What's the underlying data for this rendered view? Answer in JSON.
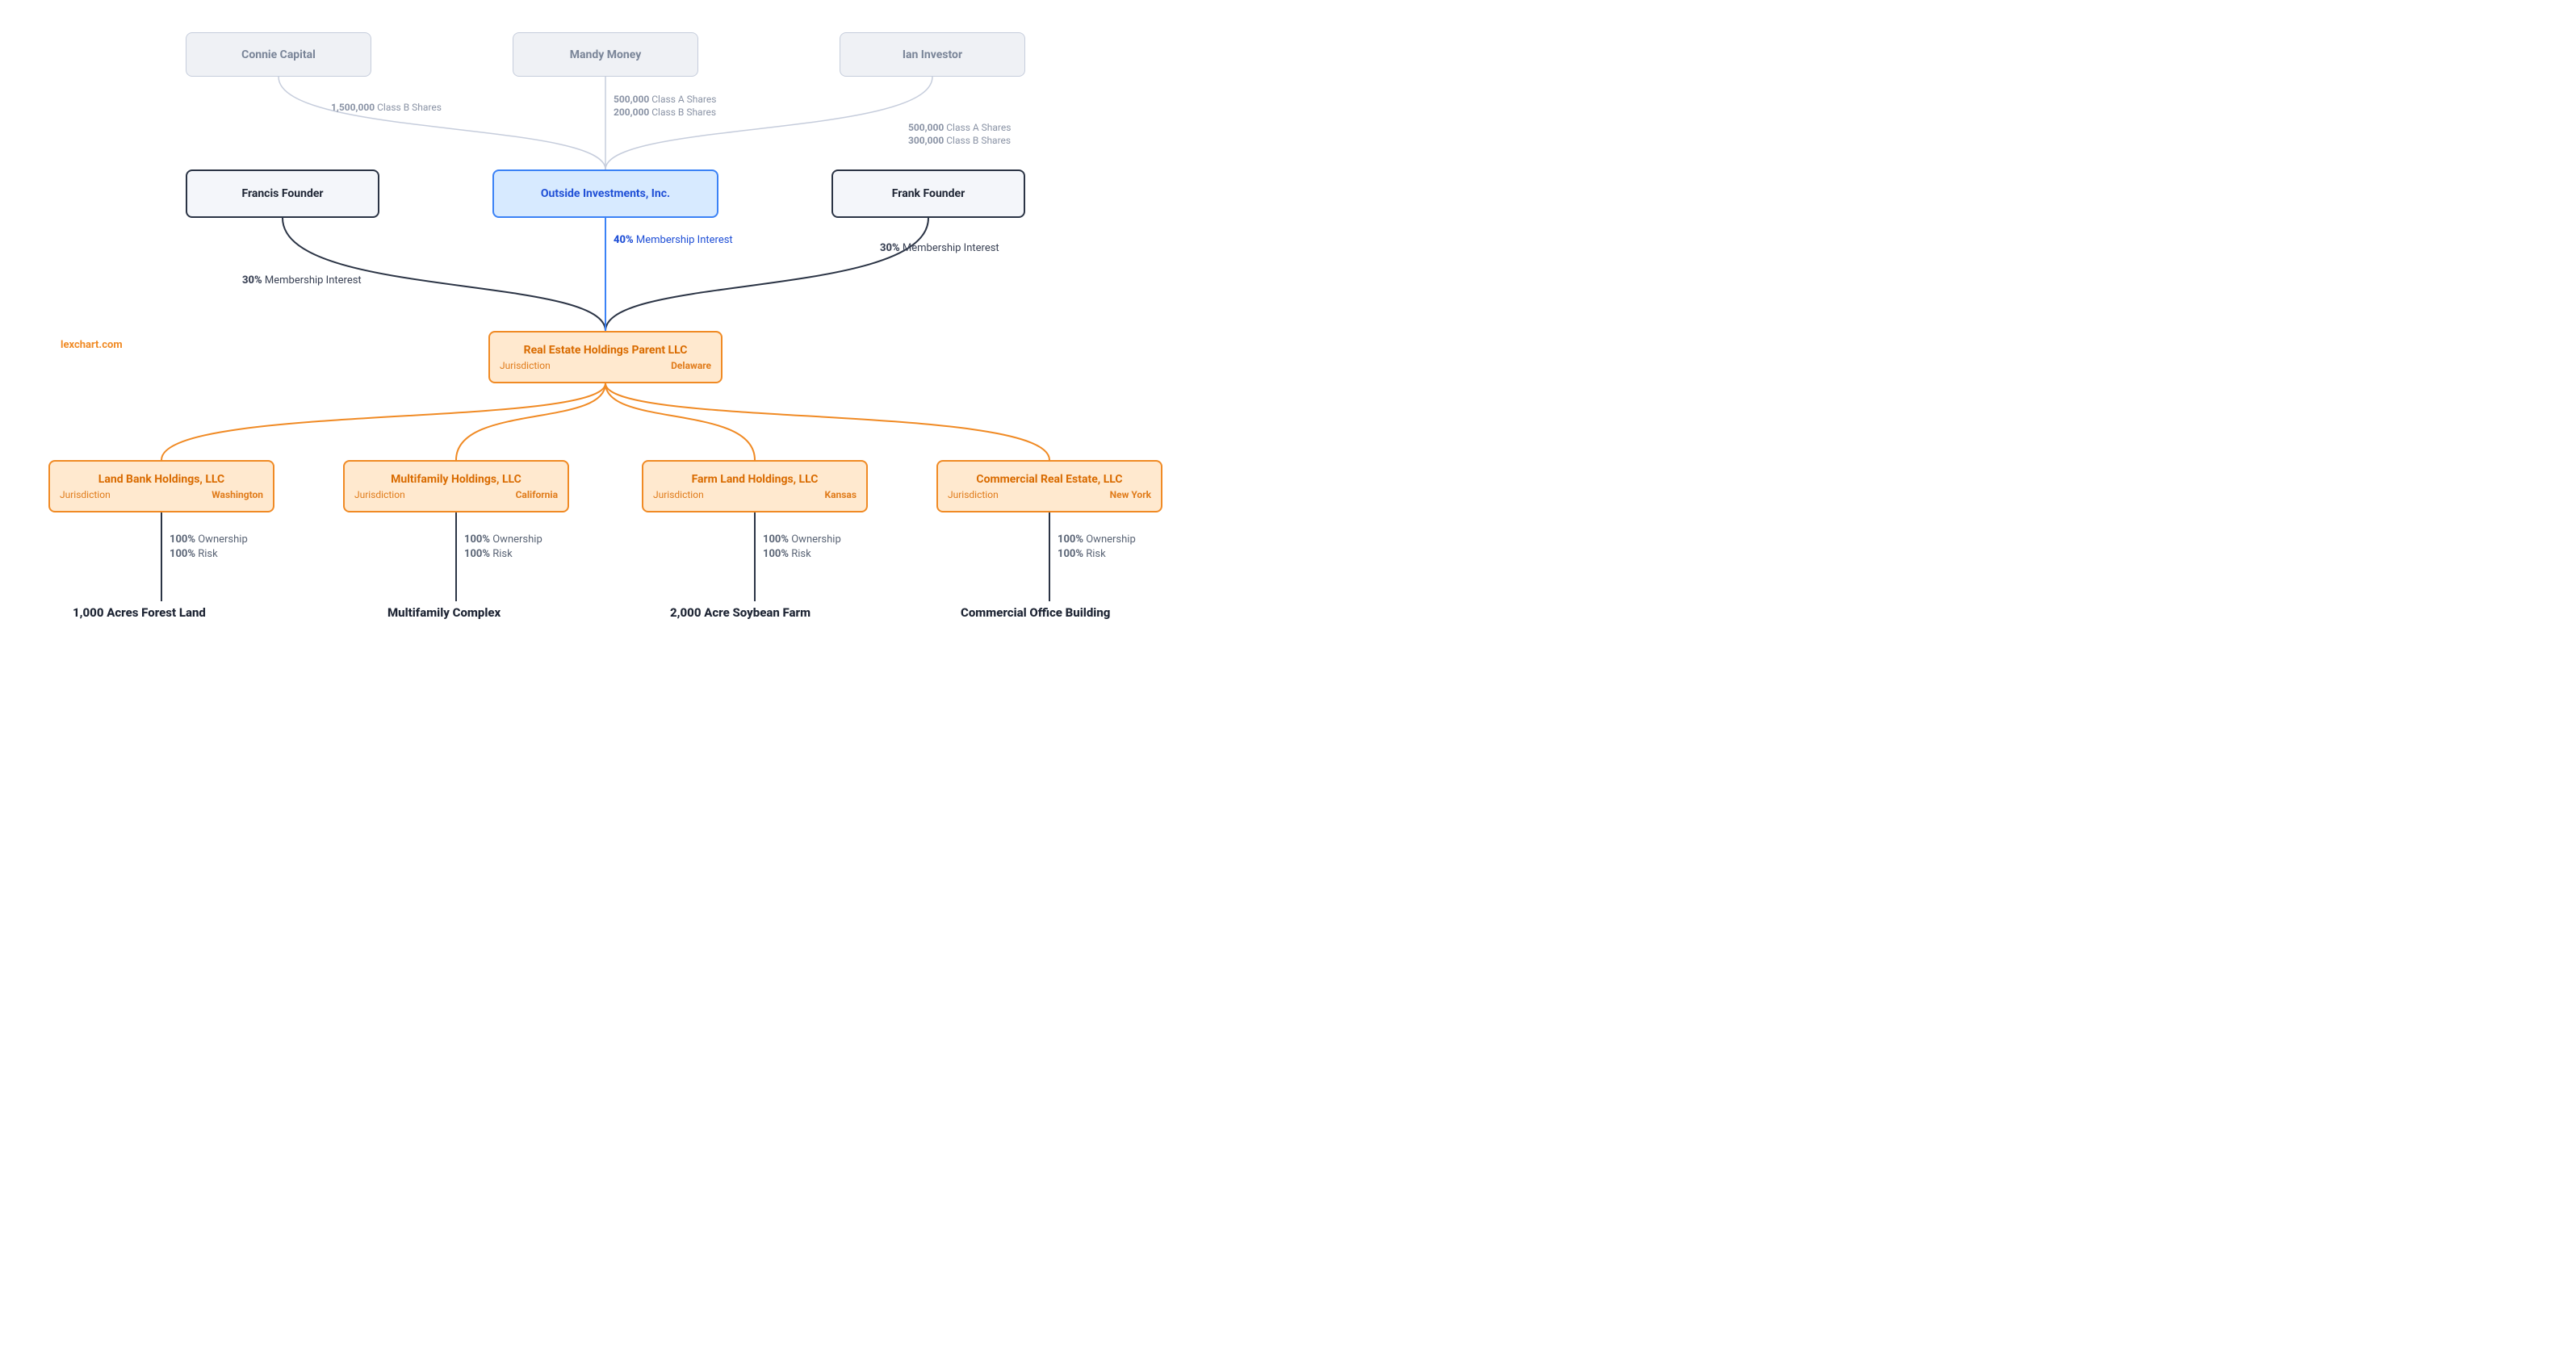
{
  "watermark": "lexchart.com",
  "investors": {
    "connie": "Connie Capital",
    "mandy": "Mandy Money",
    "ian": "Ian Investor"
  },
  "shares": {
    "connie": {
      "line1_qty": "1,500,000",
      "line1_type": "Class B Shares"
    },
    "mandy": {
      "line1_qty": "500,000",
      "line1_type": "Class A Shares",
      "line2_qty": "200,000",
      "line2_type": "Class B Shares"
    },
    "ian": {
      "line1_qty": "500,000",
      "line1_type": "Class A Shares",
      "line2_qty": "300,000",
      "line2_type": "Class B Shares"
    }
  },
  "owners": {
    "francis": "Francis Founder",
    "outside": "Outside Investments, Inc.",
    "frank": "Frank Founder"
  },
  "membership": {
    "francis": {
      "pct": "30%",
      "label": "Membership Interest"
    },
    "outside": {
      "pct": "40%",
      "label": "Membership Interest"
    },
    "frank": {
      "pct": "30%",
      "label": "Membership Interest"
    }
  },
  "parent": {
    "name": "Real Estate Holdings Parent LLC",
    "juris_label": "Jurisdiction",
    "juris_value": "Delaware"
  },
  "subs": {
    "land": {
      "name": "Land Bank Holdings, LLC",
      "juris_label": "Jurisdiction",
      "juris_value": "Washington"
    },
    "multi": {
      "name": "Multifamily Holdings, LLC",
      "juris_label": "Jurisdiction",
      "juris_value": "California"
    },
    "farm": {
      "name": "Farm Land Holdings, LLC",
      "juris_label": "Jurisdiction",
      "juris_value": "Kansas"
    },
    "comm": {
      "name": "Commercial Real Estate, LLC",
      "juris_label": "Jurisdiction",
      "juris_value": "New York"
    }
  },
  "own": {
    "pct": "100%",
    "ownership": "Ownership",
    "risk": "Risk"
  },
  "assets": {
    "land": "1,000 Acres Forest Land",
    "multi": "Multifamily Complex",
    "farm": "2,000 Acre Soybean Farm",
    "comm": "Commercial Office Building"
  }
}
